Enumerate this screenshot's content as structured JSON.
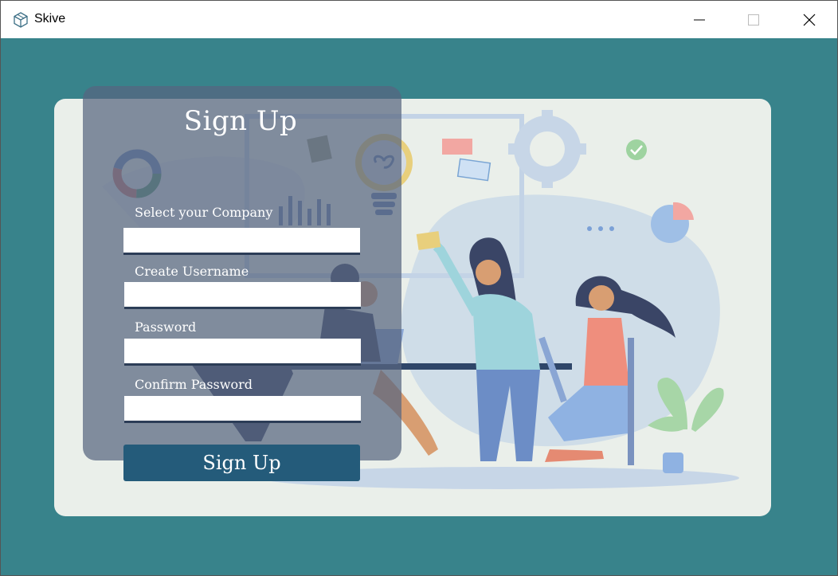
{
  "window": {
    "title": "Skive",
    "app_icon": "cube-logo-icon",
    "controls": {
      "minimize_icon": "minimize-icon",
      "maximize_icon": "maximize-icon",
      "close_icon": "close-icon"
    }
  },
  "signup": {
    "heading": "Sign Up",
    "fields": [
      {
        "label": "Select your Company",
        "value": "",
        "type": "text"
      },
      {
        "label": "Create Username",
        "value": "",
        "type": "text"
      },
      {
        "label": "Password",
        "value": "",
        "type": "password"
      },
      {
        "label": "Confirm Password",
        "value": "",
        "type": "password"
      }
    ],
    "submit_label": "Sign Up"
  },
  "colors": {
    "background": "#38838b",
    "card": "#eaefea",
    "panel": "#586580",
    "button": "#245b7a",
    "text": "#ffffff"
  }
}
